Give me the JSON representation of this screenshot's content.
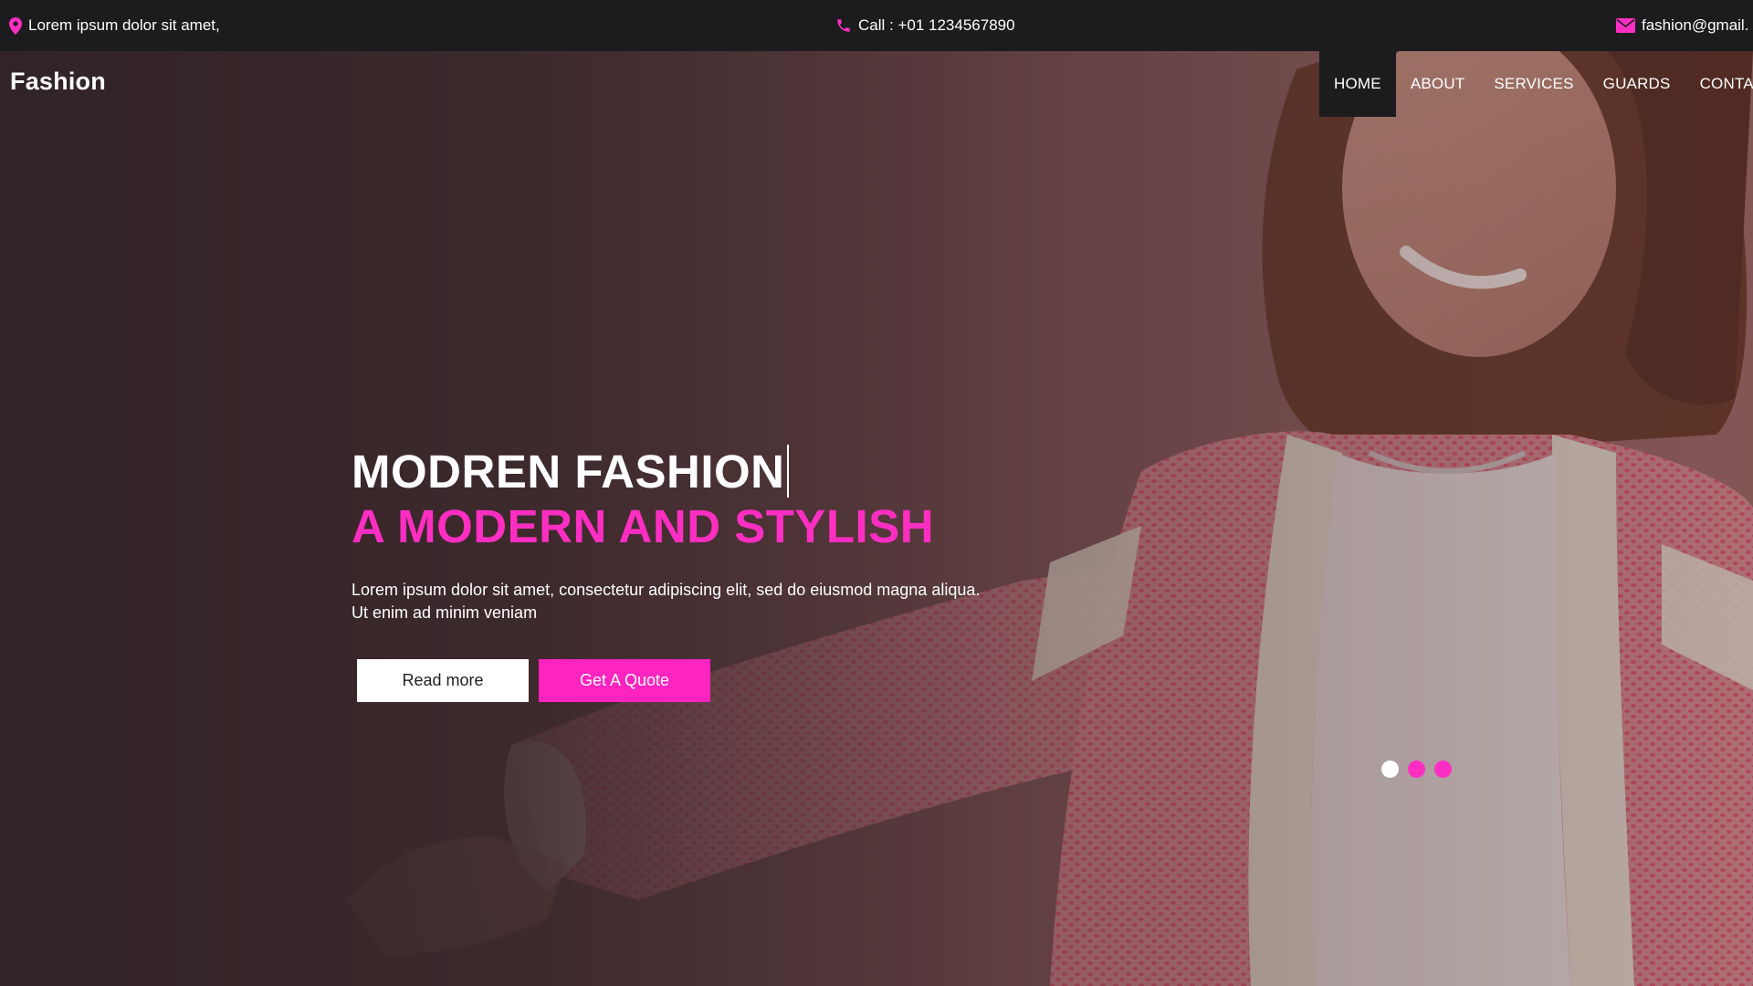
{
  "topbar": {
    "location_text": "Lorem ipsum dolor sit amet,",
    "phone_text": "Call : +01 1234567890",
    "email_text": "fashion@gmail.",
    "location_icon": "map-pin-icon",
    "phone_icon": "phone-icon",
    "email_icon": "envelope-icon"
  },
  "brand": {
    "logo_text": "Fashion"
  },
  "nav": {
    "items": [
      {
        "label": "HOME",
        "active": true
      },
      {
        "label": "ABOUT",
        "active": false
      },
      {
        "label": "SERVICES",
        "active": false
      },
      {
        "label": "GUARDS",
        "active": false
      },
      {
        "label": "CONTACT",
        "active": false
      }
    ]
  },
  "hero": {
    "title": "MODREN FASHION",
    "subtitle": "A MODERN AND STYLISH",
    "description": "Lorem ipsum dolor sit amet, consectetur adipiscing elit, sed do eiusmod magna aliqua. Ut enim ad minim veniam",
    "read_more_label": "Read more",
    "quote_label": "Get A Quote"
  },
  "carousel": {
    "slide_count": 3,
    "active_index": 0
  },
  "colors": {
    "accent": "#ff23c0",
    "topbar_bg": "#1c1c1f",
    "text": "#ffffff"
  }
}
